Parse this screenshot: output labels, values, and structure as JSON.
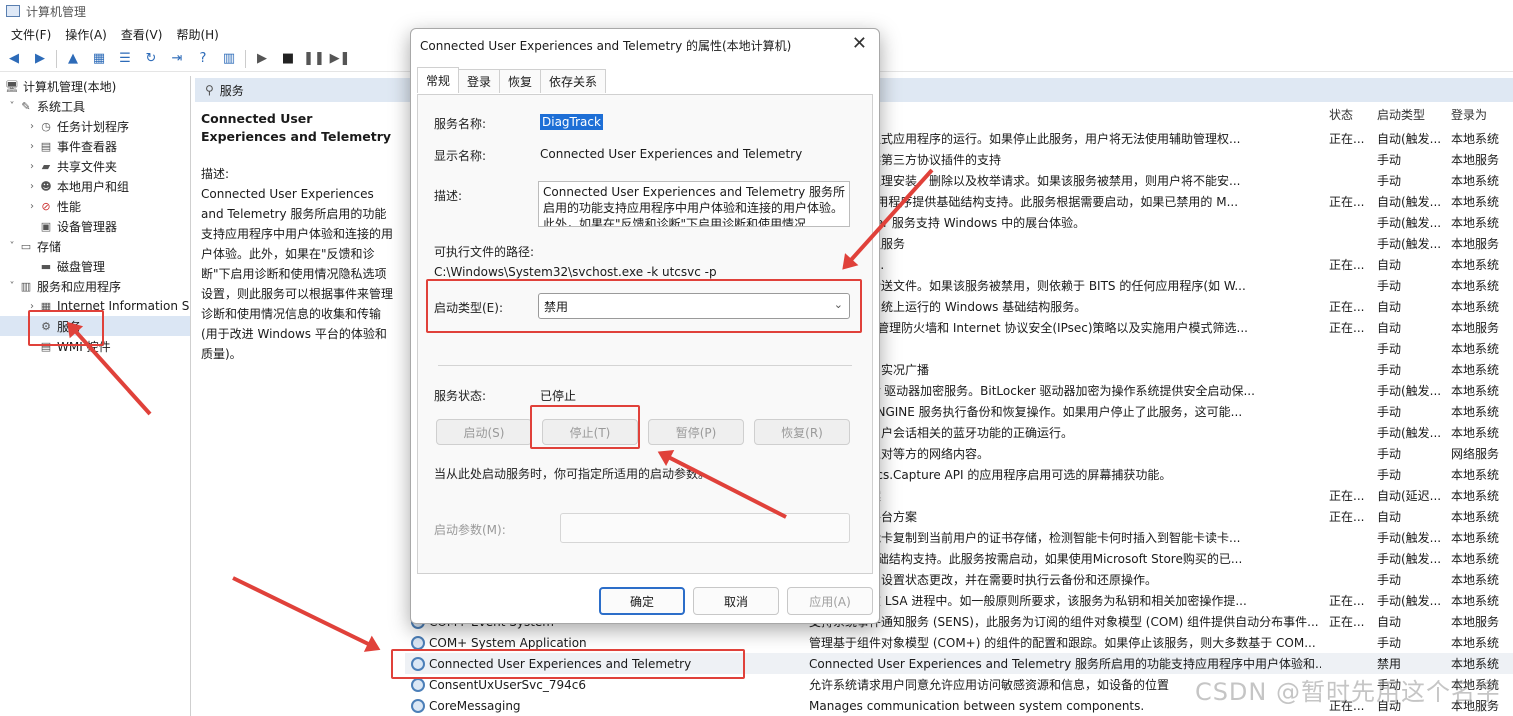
{
  "window": {
    "title": "计算机管理"
  },
  "menu": [
    "文件(F)",
    "操作(A)",
    "查看(V)",
    "帮助(H)"
  ],
  "tree": {
    "root": "计算机管理(本地)",
    "system_tools": "系统工具",
    "task_scheduler": "任务计划程序",
    "event_viewer": "事件查看器",
    "shared_folders": "共享文件夹",
    "local_users": "本地用户和组",
    "performance": "性能",
    "device_manager": "设备管理器",
    "storage": "存储",
    "disk_management": "磁盘管理",
    "services_apps": "服务和应用程序",
    "iis": "Internet Information S",
    "services": "服务",
    "wmi": "WMI 控件"
  },
  "services_pane": {
    "header": "服务",
    "selected_title": "Connected User Experiences and Telemetry",
    "desc_label": "描述:",
    "desc_text": "Connected User Experiences and Telemetry 服务所启用的功能支持应用程序中用户体验和连接的用户体验。此外，如果在\"反馈和诊断\"下启用诊断和使用情况隐私选项设置，则此服务可以根据事件来管理诊断和使用情况信息的收集和传输(用于改进 Windows 平台的体验和质量)。",
    "columns": {
      "status": "状态",
      "startup": "启动类型",
      "logon": "登录为"
    }
  },
  "service_rows": [
    {
      "name": "",
      "desc": "权限便于交互式应用程序的运行。如果停止此服务，用户将无法使用辅助管理权...",
      "status": "正在...",
      "startup": "自动(触发...",
      "logon": "本地系统"
    },
    {
      "name": "",
      "desc": "连接共享提供第三方协议插件的支持",
      "status": "",
      "startup": "手动",
      "logon": "本地服务"
    },
    {
      "name": "",
      "desc": "部署的软件处理安装、删除以及枚举请求。如果该服务被禁用，则用户将不能安...",
      "status": "",
      "startup": "手动",
      "logon": "本地系统"
    },
    {
      "name": "",
      "desc": "oft Store 应用程序提供基础结构支持。此服务根据需要启动，如果已禁用的 M...",
      "status": "正在...",
      "startup": "自动(触发...",
      "logon": "本地系统"
    },
    {
      "name": "",
      "desc": "cessManager 服务支持 Windows 中的展台体验。",
      "status": "",
      "startup": "手动(触发...",
      "logon": "本地系统"
    },
    {
      "name": "",
      "desc": "控制传输协议服务",
      "status": "",
      "startup": "手动(触发...",
      "logon": "本地服务"
    },
    {
      "name": "",
      "desc": "port service.",
      "status": "正在...",
      "startup": "自动",
      "logon": "本地系统"
    },
    {
      "name": "",
      "desc": "带宽在后台传送文件。如果该服务被禁用，则依赖于 BITS 的任何应用程序(如 W...",
      "status": "",
      "startup": "手动",
      "logon": "本地系统"
    },
    {
      "name": "",
      "desc": "任务可以在系统上运行的 Windows 基础结构服务。",
      "status": "正在...",
      "startup": "自动",
      "logon": "本地系统"
    },
    {
      "name": "",
      "desc": "(BFE)是一种管理防火墙和 Internet 协议安全(IPsec)策略以及实施用户模式筛选...",
      "status": "正在...",
      "startup": "自动",
      "logon": "本地服务"
    },
    {
      "name": "",
      "desc": "",
      "status": "",
      "startup": "手动",
      "logon": "本地系统"
    },
    {
      "name": "",
      "desc": "于游戏录制和实况广播",
      "status": "",
      "startup": "手动",
      "logon": "本地系统"
    },
    {
      "name": "",
      "desc": "戏 BitLocker 驱动器加密服务。BitLocker 驱动器加密为操作系统提供安全启动保...",
      "status": "",
      "startup": "手动(触发...",
      "logon": "本地系统"
    },
    {
      "name": "",
      "desc": "份使用 WBENGINE 服务执行备份和恢复操作。如果用户停止了此服务，这可能...",
      "status": "",
      "startup": "手动",
      "logon": "本地系统"
    },
    {
      "name": "",
      "desc": "支持与每个用户会话相关的蓝牙功能的正确运行。",
      "status": "",
      "startup": "手动(触发...",
      "logon": "本地系统"
    },
    {
      "name": "",
      "desc": "自本地子网上对等方的网络内容。",
      "status": "",
      "startup": "手动",
      "logon": "网络服务"
    },
    {
      "name": "",
      "desc": "ows.Graphics.Capture API 的应用程序启用可选的屏幕捕获功能。",
      "status": "",
      "startup": "手动",
      "logon": "本地系统"
    },
    {
      "name": "",
      "desc": "于剪贴板方案",
      "status": "正在...",
      "startup": "自动(延迟...",
      "logon": "本地系统"
    },
    {
      "name": "",
      "desc": "于连接设备平台方案",
      "status": "正在...",
      "startup": "自动",
      "logon": "本地系统"
    },
    {
      "name": "",
      "desc": "根证书从智能卡复制到当前用户的证书存储，检测智能卡何时插入到智能卡读卡...",
      "status": "",
      "startup": "手动(触发...",
      "logon": "本地系统"
    },
    {
      "name": "",
      "desc": "Store提供基础结构支持。此服务按需启动，如果使用Microsoft Store购买的已...",
      "status": "",
      "startup": "手动(触发...",
      "logon": "本地系统"
    },
    {
      "name": "",
      "desc": "解应用程序和设置状态更改，并在需要时执行云备份和还原操作。",
      "status": "",
      "startup": "手动",
      "logon": "本地系统"
    },
    {
      "name": "",
      "desc": "简服务宿主在 LSA 进程中。如一般原则所要求，该服务为私钥和相关加密操作提...",
      "status": "正在...",
      "startup": "手动(触发...",
      "logon": "本地系统"
    },
    {
      "name": "COM+ Event System",
      "desc": "支持系统事件通知服务 (SENS)，此服务为订阅的组件对象模型 (COM) 组件提供自动分布事件...",
      "status": "正在...",
      "startup": "自动",
      "logon": "本地服务"
    },
    {
      "name": "COM+ System Application",
      "desc": "管理基于组件对象模型 (COM+) 的组件的配置和跟踪。如果停止该服务，则大多数基于 COM...",
      "status": "",
      "startup": "手动",
      "logon": "本地系统"
    },
    {
      "name": "Connected User Experiences and Telemetry",
      "desc": "Connected User Experiences and Telemetry 服务所启用的功能支持应用程序中用户体验和...",
      "status": "",
      "startup": "禁用",
      "logon": "本地系统"
    },
    {
      "name": "ConsentUxUserSvc_794c6",
      "desc": "允许系统请求用户同意允许应用访问敏感资源和信息，如设备的位置",
      "status": "",
      "startup": "手动",
      "logon": "本地系统"
    },
    {
      "name": "CoreMessaging",
      "desc": "Manages communication between system components.",
      "status": "正在...",
      "startup": "自动",
      "logon": "本地服务"
    }
  ],
  "dialog": {
    "title": "Connected User Experiences and Telemetry 的属性(本地计算机)",
    "tabs": [
      "常规",
      "登录",
      "恢复",
      "依存关系"
    ],
    "service_name_label": "服务名称:",
    "service_name": "DiagTrack",
    "display_name_label": "显示名称:",
    "display_name": "Connected User Experiences and Telemetry",
    "description_label": "描述:",
    "description": "Connected User Experiences and Telemetry 服务所启用的功能支持应用程序中用户体验和连接的用户体验。此外，如果在\"反馈和诊断\"下启用诊断和使用情况",
    "path_label": "可执行文件的路径:",
    "path": "C:\\Windows\\System32\\svchost.exe -k utcsvc -p",
    "startup_type_label": "启动类型(E):",
    "startup_type": "禁用",
    "status_label": "服务状态:",
    "status": "已停止",
    "btn_start": "启动(S)",
    "btn_stop": "停止(T)",
    "btn_pause": "暂停(P)",
    "btn_resume": "恢复(R)",
    "hint": "当从此处启动服务时，你可指定所适用的启动参数。",
    "params_label": "启动参数(M):",
    "ok": "确定",
    "cancel": "取消",
    "apply": "应用(A)"
  },
  "watermark": "CSDN @暂时先用这个名字",
  "colors": {
    "annotation": "#e0413a",
    "selection": "#1e6fd6",
    "header_bg": "#dfe8f3"
  }
}
